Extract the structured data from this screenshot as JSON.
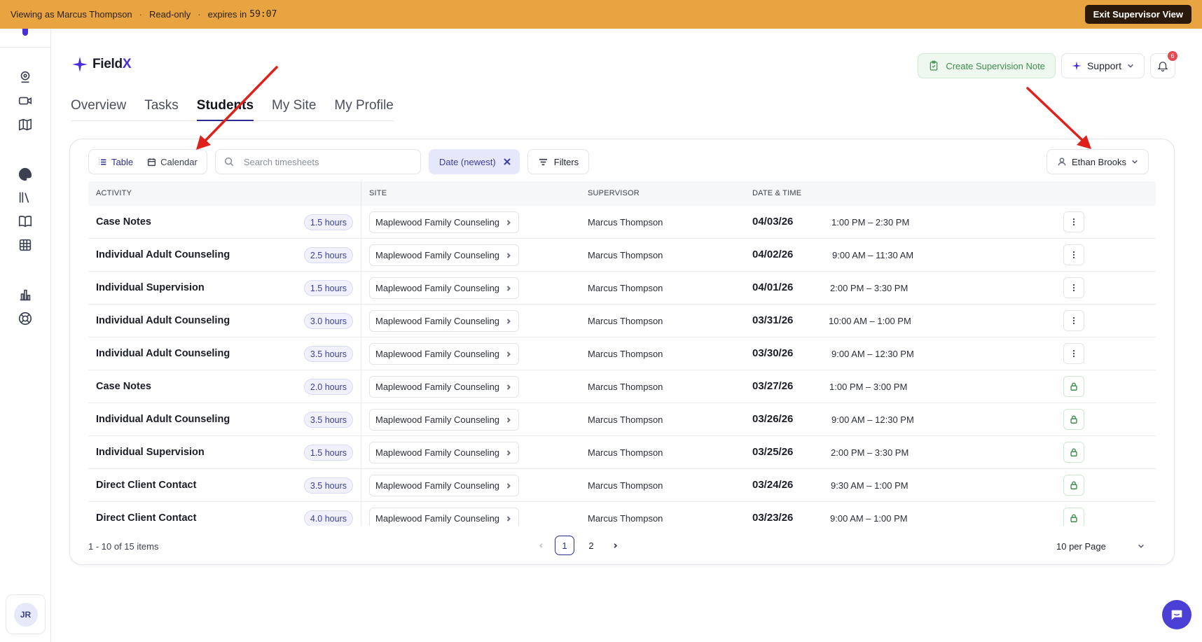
{
  "banner": {
    "viewing": "Viewing as Marcus Thompson",
    "mode": "Read-only",
    "expires_label": "expires in",
    "timer": "59:07",
    "exit_label": "Exit Supervisor View",
    "color": "#e8a440"
  },
  "rail": {
    "icons": [
      "webcam-icon",
      "video-icon",
      "map-icon",
      "palette-icon",
      "library-icon",
      "book-icon",
      "grid-icon",
      "chart-icon",
      "lifebuoy-icon"
    ],
    "avatar_initials": "JR"
  },
  "header": {
    "logo_main": "Field",
    "logo_accent": "X",
    "create_note_label": "Create Supervision Note",
    "support_label": "Support",
    "notifications_count": "6",
    "accent": "#4b2fd6"
  },
  "tabs": [
    {
      "label": "Overview",
      "active": false
    },
    {
      "label": "Tasks",
      "active": false
    },
    {
      "label": "Students",
      "active": true
    },
    {
      "label": "My Site",
      "active": false
    },
    {
      "label": "My Profile",
      "active": false
    }
  ],
  "toolbar": {
    "view_table": "Table",
    "view_calendar": "Calendar",
    "search_placeholder": "Search timesheets",
    "sort_chip": "Date (newest)",
    "filters_label": "Filters",
    "student_select": "Ethan Brooks"
  },
  "table": {
    "headers": {
      "activity": "ACTIVITY",
      "site": "SITE",
      "supervisor": "SUPERVISOR",
      "datetime": "DATE & TIME"
    },
    "rows": [
      {
        "activity": "Case Notes",
        "hours": "1.5 hours",
        "site": "Maplewood Family Counseling",
        "supervisor": "Marcus Thompson",
        "date": "04/03/26",
        "time": "1:00 PM – 2:30 PM",
        "action": "more"
      },
      {
        "activity": "Individual Adult Counseling",
        "hours": "2.5 hours",
        "site": "Maplewood Family Counseling",
        "supervisor": "Marcus Thompson",
        "date": "04/02/26",
        "time": "9:00 AM – 11:30 AM",
        "action": "more"
      },
      {
        "activity": "Individual Supervision",
        "hours": "1.5 hours",
        "site": "Maplewood Family Counseling",
        "supervisor": "Marcus Thompson",
        "date": "04/01/26",
        "time": "2:00 PM – 3:30 PM",
        "action": "more"
      },
      {
        "activity": "Individual Adult Counseling",
        "hours": "3.0 hours",
        "site": "Maplewood Family Counseling",
        "supervisor": "Marcus Thompson",
        "date": "03/31/26",
        "time": "10:00 AM – 1:00 PM",
        "action": "more"
      },
      {
        "activity": "Individual Adult Counseling",
        "hours": "3.5 hours",
        "site": "Maplewood Family Counseling",
        "supervisor": "Marcus Thompson",
        "date": "03/30/26",
        "time": "9:00 AM – 12:30 PM",
        "action": "more"
      },
      {
        "activity": "Case Notes",
        "hours": "2.0 hours",
        "site": "Maplewood Family Counseling",
        "supervisor": "Marcus Thompson",
        "date": "03/27/26",
        "time": "1:00 PM – 3:00 PM",
        "action": "lock"
      },
      {
        "activity": "Individual Adult Counseling",
        "hours": "3.5 hours",
        "site": "Maplewood Family Counseling",
        "supervisor": "Marcus Thompson",
        "date": "03/26/26",
        "time": "9:00 AM – 12:30 PM",
        "action": "lock"
      },
      {
        "activity": "Individual Supervision",
        "hours": "1.5 hours",
        "site": "Maplewood Family Counseling",
        "supervisor": "Marcus Thompson",
        "date": "03/25/26",
        "time": "2:00 PM – 3:30 PM",
        "action": "lock"
      },
      {
        "activity": "Direct Client Contact",
        "hours": "3.5 hours",
        "site": "Maplewood Family Counseling",
        "supervisor": "Marcus Thompson",
        "date": "03/24/26",
        "time": "9:30 AM – 1:00 PM",
        "action": "lock"
      },
      {
        "activity": "Direct Client Contact",
        "hours": "4.0 hours",
        "site": "Maplewood Family Counseling",
        "supervisor": "Marcus Thompson",
        "date": "03/23/26",
        "time": "9:00 AM – 1:00 PM",
        "action": "lock"
      }
    ]
  },
  "footer": {
    "summary": "1 - 10 of 15 items",
    "pages": [
      "1",
      "2"
    ],
    "current_page": "1",
    "per_page": "10 per Page"
  },
  "colors": {
    "lock_green": "#3f8f4c",
    "annotation_red": "#e0201b",
    "chat_bubble": "#4b3fd6"
  }
}
